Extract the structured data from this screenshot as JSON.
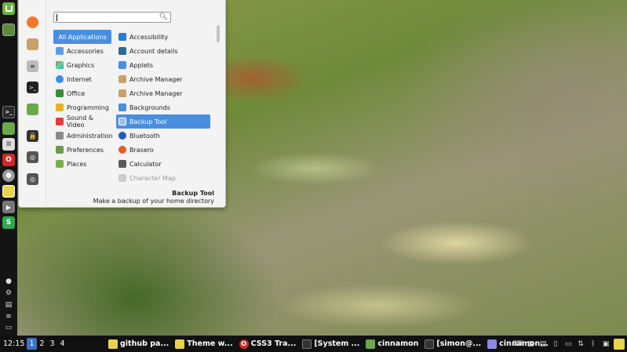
{
  "colors": {
    "accent": "#4a8ee0",
    "panel": "#141414",
    "menu_bg": "#f3f3f3",
    "workspace_active": "#3c74c4"
  },
  "left_panel": {
    "items": [
      {
        "name": "mint-menu-icon",
        "color": "#6cb33f",
        "glyph": "m"
      },
      {
        "name": "desktop-icon",
        "color": "#5b8a3c",
        "glyph": ""
      },
      {
        "name": "terminal-icon",
        "color": "#333333",
        "glyph": ">"
      },
      {
        "name": "files-icon",
        "color": "#6ba84a",
        "glyph": ""
      },
      {
        "name": "settings-icon",
        "color": "#dddddd",
        "glyph": "≡"
      },
      {
        "name": "opera-icon",
        "color": "#d12a2a",
        "glyph": "O"
      },
      {
        "name": "pidgin-icon",
        "color": "#999999",
        "glyph": "●"
      },
      {
        "name": "note-icon",
        "color": "#e8d44a",
        "glyph": ""
      },
      {
        "name": "play-icon",
        "color": "#777777",
        "glyph": "▶"
      },
      {
        "name": "skype-icon",
        "color": "#2ea84f",
        "glyph": "S"
      }
    ],
    "system": [
      "user-icon",
      "gear-icon",
      "clipboard-icon",
      "wifi-icon",
      "display-icon"
    ]
  },
  "menu": {
    "search": {
      "placeholder": "",
      "value": ""
    },
    "favorites": [
      {
        "name": "firefox-icon",
        "color": "#f07a2a"
      },
      {
        "name": "package-icon",
        "color": "#c9a16a"
      },
      {
        "name": "toggle-settings-icon",
        "color": "#888888"
      },
      {
        "name": "terminal-icon",
        "color": "#222222"
      },
      {
        "name": "folder-icon",
        "color": "#6ba84a"
      },
      {
        "name": "lock-icon",
        "color": "#333333"
      },
      {
        "name": "logout-icon",
        "color": "#555555"
      },
      {
        "name": "power-icon",
        "color": "#555555"
      }
    ],
    "categories": [
      {
        "label": "All Applications",
        "icon": "",
        "selected": true
      },
      {
        "label": "Accessories",
        "icon": "#5a9ee8"
      },
      {
        "label": "Graphics",
        "icon": "#e84a8a"
      },
      {
        "label": "Internet",
        "icon": "#3a8ee8"
      },
      {
        "label": "Office",
        "icon": "#3a8a3a"
      },
      {
        "label": "Programming",
        "icon": "#e8b02a"
      },
      {
        "label": "Sound & Video",
        "icon": "#e83a3a"
      },
      {
        "label": "Administration",
        "icon": "#8a8a8a"
      },
      {
        "label": "Preferences",
        "icon": "#6a9a4a"
      },
      {
        "label": "Places",
        "icon": "#7ab04a"
      }
    ],
    "apps": [
      {
        "label": "Accessibility",
        "icon": "#2a7ad8"
      },
      {
        "label": "Account details",
        "icon": "#2a6a9a"
      },
      {
        "label": "Applets",
        "icon": "#4a8ee0"
      },
      {
        "label": "Archive Manager",
        "icon": "#c9a16a"
      },
      {
        "label": "Archive Manager",
        "icon": "#c9a16a"
      },
      {
        "label": "Backgrounds",
        "icon": "#4a8ee0"
      },
      {
        "label": "Backup Tool",
        "icon": "#9ac0e8",
        "selected": true
      },
      {
        "label": "Bluetooth",
        "icon": "#2a5ab8"
      },
      {
        "label": "Brasero",
        "icon": "#e85a2a"
      },
      {
        "label": "Calculator",
        "icon": "#5a5a5a"
      },
      {
        "label": "Character Map",
        "icon": "#bbbbbb",
        "faded": true
      }
    ],
    "description": {
      "title": "Backup Tool",
      "text": "Make a backup of your home directory"
    }
  },
  "bottom_panel": {
    "clock": "12:15",
    "workspaces": [
      "1",
      "2",
      "3",
      "4"
    ],
    "active_workspace": "1",
    "tasks": [
      {
        "label": "github pa...",
        "icon": "note-icon",
        "color": "#e8d44a"
      },
      {
        "label": "Theme w...",
        "icon": "note-icon",
        "color": "#e8d44a"
      },
      {
        "label": "CSS3 Tra...",
        "icon": "opera-icon",
        "color": "#d12a2a"
      },
      {
        "label": "[System ...",
        "icon": "terminal-icon",
        "color": "#333333"
      },
      {
        "label": "cinnamon",
        "icon": "folder-icon",
        "color": "#6ba84a"
      },
      {
        "label": "[simon@...",
        "icon": "terminal-icon",
        "color": "#333333"
      },
      {
        "label": "cinnamon...",
        "icon": "text-editor-icon",
        "color": "#8a8ae0"
      }
    ],
    "tray": [
      "keyboard-icon",
      "calendar-icon",
      "clipboard-icon",
      "battery-icon",
      "monitor-icon",
      "network-icon",
      "bluetooth-icon",
      "display-icon",
      "note-icon"
    ]
  }
}
